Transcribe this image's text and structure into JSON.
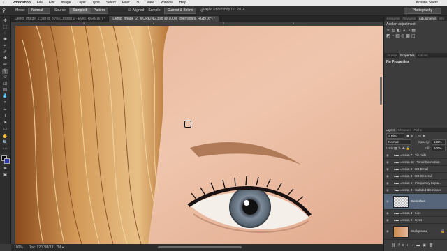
{
  "menubar": {
    "apple": "",
    "items": [
      "Photoshop",
      "File",
      "Edit",
      "Image",
      "Layer",
      "Type",
      "Select",
      "Filter",
      "3D",
      "View",
      "Window",
      "Help"
    ],
    "user": "Kristina Sherk"
  },
  "app_title": "Adobe Photoshop CC 2014",
  "options": {
    "mode_label": "Mode:",
    "mode_value": "Normal",
    "source_label": "Source:",
    "source_sampled": "Sampled",
    "source_pattern": "Pattern",
    "aligned_label": "Aligned",
    "sample_label": "Sample:",
    "sample_value": "Current & Below",
    "workspace": "Photography"
  },
  "tabs": [
    {
      "label": "Demo_Image_2.psd @ 50% (Lesson 2 - Eyes, RGB/16*) *"
    },
    {
      "label": "Demo_Image_2_WORKING.psd @ 100% (Blemishes, RGB/16*) *"
    }
  ],
  "ruler_marks": [
    "5",
    "6",
    "7",
    "8"
  ],
  "status": {
    "zoom": "100%",
    "doc": "Doc: 120.3M/331.7M"
  },
  "panels": {
    "top_tabs": [
      "Histogram",
      "Navigator",
      "Adjustments",
      "Info"
    ],
    "add_adjustment": "Add an adjustment",
    "mid_tabs": [
      "Libraries",
      "Properties",
      "Actions"
    ],
    "no_properties": "No Properties",
    "layers_tabs": [
      "Layers",
      "Channels",
      "Paths"
    ],
    "kind_label": "Kind",
    "blend_mode": "Normal",
    "opacity_label": "Opacity:",
    "opacity_value": "100%",
    "lock_label": "Lock:",
    "fill_label": "Fill:",
    "fill_value": "100%",
    "layers": [
      {
        "name": "Lesson 7 - Vic Aids",
        "type": "group"
      },
      {
        "name": "Lesson 10 - Tonal Correction",
        "type": "group"
      },
      {
        "name": "Lesson 9 - DB Detail",
        "type": "group"
      },
      {
        "name": "Lesson 8 - DB General",
        "type": "group"
      },
      {
        "name": "Lesson 5 - Frequency Separ...",
        "type": "group"
      },
      {
        "name": "Lesson 4 - Isolated Blemishes",
        "type": "group"
      },
      {
        "name": "Blemishes",
        "type": "layer",
        "selected": true
      },
      {
        "name": "Lesson 3 - Lips",
        "type": "group"
      },
      {
        "name": "Lesson 2 - Eyes",
        "type": "group"
      },
      {
        "name": "Background",
        "type": "background"
      }
    ]
  },
  "colors": {
    "accent_selected": "#56657a",
    "chrome_dark": "#2d2d2d",
    "menubar": "#e9e9e9"
  }
}
